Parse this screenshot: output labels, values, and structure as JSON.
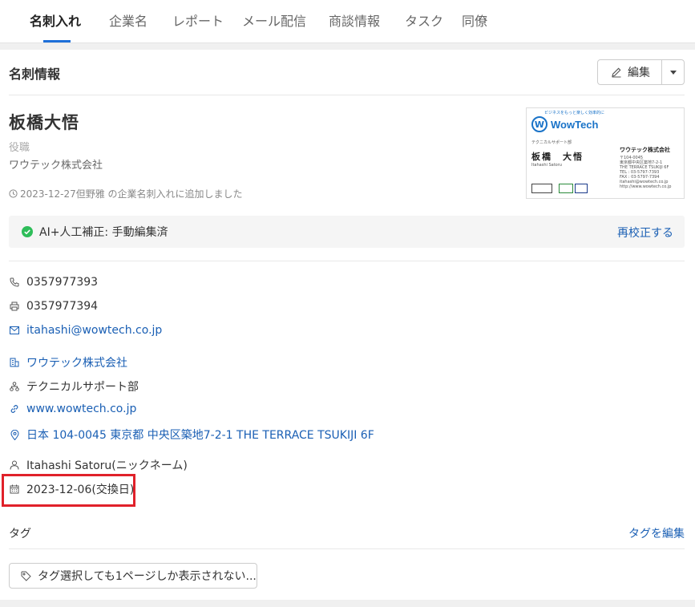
{
  "tabs": [
    {
      "label": "名刺入れ",
      "active": true
    },
    {
      "label": "企業名"
    },
    {
      "label": "レポート"
    },
    {
      "label": "メール配信"
    },
    {
      "label": "商談情報"
    },
    {
      "label": "タスク"
    },
    {
      "label": "同僚"
    }
  ],
  "section": {
    "title": "名刺情報",
    "edit_label": "編集"
  },
  "contact": {
    "name": "板橋大悟",
    "role": "役職",
    "company": "ワウテック株式会社",
    "added_note": "2023-12-27但野雅 の企業名刺入れに追加しました"
  },
  "card_image": {
    "logo_letter": "W",
    "logo_text": "WowTech",
    "tagline": "ビジネスをもっと楽しく効率的に",
    "dept": "テクニカルサポート部",
    "name": "板橋　大悟",
    "romaji": "Itahashi Satoru",
    "company": "ワウテック株式会社",
    "address_lines": [
      "〒104-0045",
      "東京都中央区築地7-2-1",
      "THE TERRACE TSUKIJI 6F",
      "TEL : 03-5797-7393",
      "FAX : 03-5797-7394",
      "itahashi@wowtech.co.jp",
      "http://www.wowtech.co.jp"
    ]
  },
  "ai_status": {
    "label": "AI+人工補正: 手動編集済",
    "recheck_label": "再校正する",
    "status_color": "#2ebd59"
  },
  "details": {
    "phone": "0357977393",
    "fax": "0357977394",
    "email": "itahashi@wowtech.co.jp",
    "company": "ワウテック株式会社",
    "department": "テクニカルサポート部",
    "website": "www.wowtech.co.jp",
    "address": "日本 104-0045 東京都 中央区築地7-2-1 THE TERRACE TSUKIJI 6F",
    "nickname": "Itahashi Satoru(ニックネーム)",
    "exchange_date": "2023-12-06(交換日)"
  },
  "tags": {
    "label": "タグ",
    "edit_label": "タグを編集",
    "select_label": "タグ選択しても1ページしか表示されない..."
  },
  "colors": {
    "link": "#1a5fb4",
    "tab_underline": "#1e6fd9",
    "highlight": "#e0212a"
  }
}
